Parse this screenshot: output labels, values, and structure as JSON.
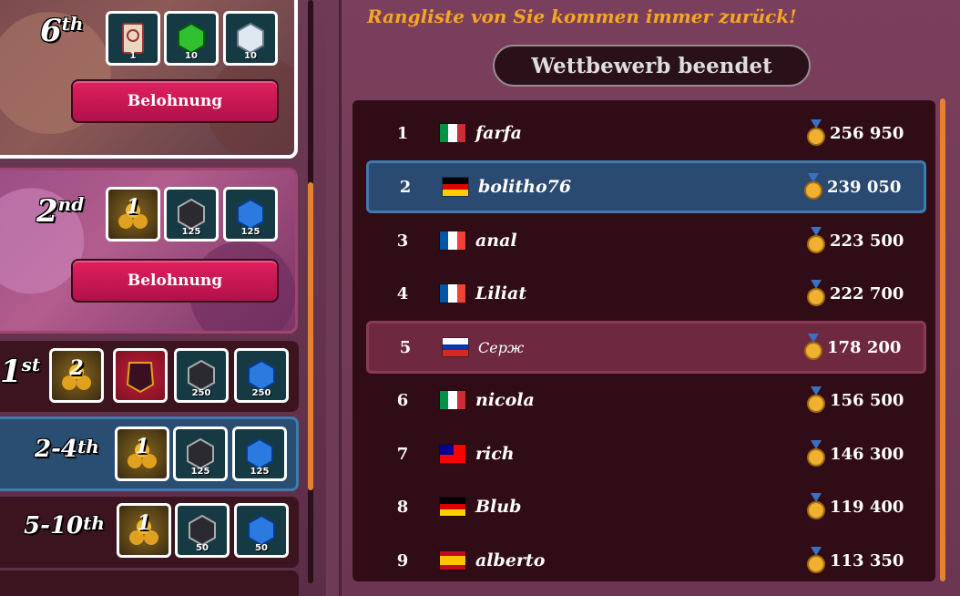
{
  "header": {
    "title": "Rangliste von Sie kommen immer zurück!",
    "status": "Wettbewerb beendet"
  },
  "rewards": {
    "claim_label": "Belohnung",
    "cards": [
      {
        "rank_num": "6",
        "rank_suffix": "th",
        "items": [
          {
            "icon": "ticket-icon",
            "qty": "1"
          },
          {
            "icon": "green-gem-icon",
            "qty": "10"
          },
          {
            "icon": "white-gem-icon",
            "qty": "10"
          }
        ]
      },
      {
        "rank_num": "2",
        "rank_suffix": "nd",
        "items": [
          {
            "icon": "gold-chest-icon",
            "qty": "1"
          },
          {
            "icon": "black-gem-icon",
            "qty": "125"
          },
          {
            "icon": "blue-gem-icon",
            "qty": "125"
          }
        ]
      }
    ],
    "tiers": [
      {
        "rank_num": "1",
        "rank_suffix": "st",
        "items": [
          {
            "icon": "gold-chest-icon",
            "qty": "2"
          },
          {
            "icon": "armor-icon",
            "qty": ""
          },
          {
            "icon": "black-gem-icon",
            "qty": "250"
          },
          {
            "icon": "blue-gem-icon",
            "qty": "250"
          }
        ]
      },
      {
        "rank_num": "2-4",
        "rank_suffix": "th",
        "items": [
          {
            "icon": "gold-chest-icon",
            "qty": "1"
          },
          {
            "icon": "black-gem-icon",
            "qty": "125"
          },
          {
            "icon": "blue-gem-icon",
            "qty": "125"
          }
        ]
      },
      {
        "rank_num": "5-10",
        "rank_suffix": "th",
        "items": [
          {
            "icon": "gold-chest-icon",
            "qty": "1"
          },
          {
            "icon": "black-gem-icon",
            "qty": "50"
          },
          {
            "icon": "blue-gem-icon",
            "qty": "50"
          }
        ]
      }
    ]
  },
  "leaderboard": [
    {
      "rank": "1",
      "flag": "Italy",
      "name": "farfa",
      "score": "256 950"
    },
    {
      "rank": "2",
      "flag": "Germany",
      "name": "bolitho76",
      "score": "239 050"
    },
    {
      "rank": "3",
      "flag": "France",
      "name": "anal",
      "score": "223 500"
    },
    {
      "rank": "4",
      "flag": "France",
      "name": "Liliat",
      "score": "222 700"
    },
    {
      "rank": "5",
      "flag": "Russia",
      "name": "Серж",
      "score": "178 200"
    },
    {
      "rank": "6",
      "flag": "Italy",
      "name": "nicola",
      "score": "156 500"
    },
    {
      "rank": "7",
      "flag": "Taiwan",
      "name": "rich",
      "score": "146 300"
    },
    {
      "rank": "8",
      "flag": "Germany",
      "name": "Blub",
      "score": "119 400"
    },
    {
      "rank": "9",
      "flag": "Spain",
      "name": "alberto",
      "score": "113 350"
    }
  ],
  "colors": {
    "accent_orange": "#f5a623",
    "button_pink": "#d0175a",
    "highlight_blue": "#2a4a72",
    "friend_row": "#6e2840"
  }
}
